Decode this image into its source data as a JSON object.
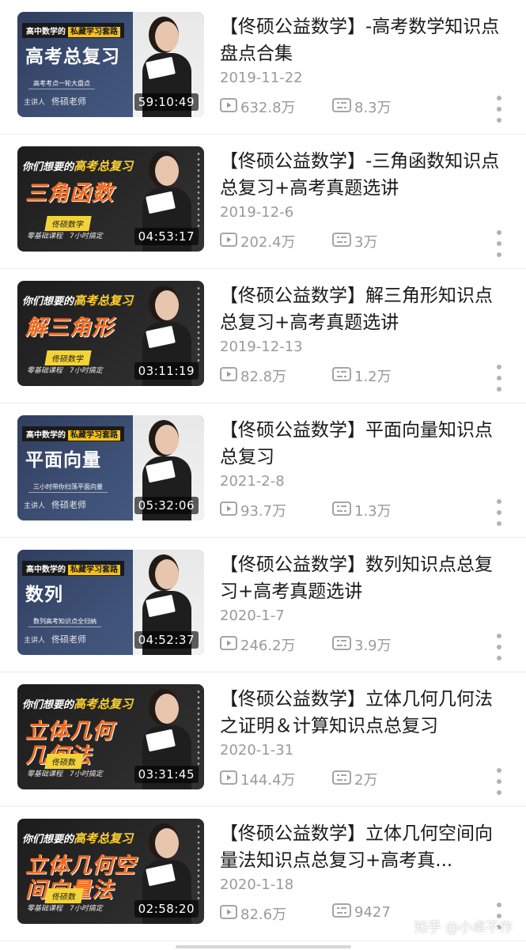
{
  "videos": [
    {
      "style": "blue",
      "cover_top": "高中数学的",
      "cover_top_hl": "私藏学习套路",
      "cover_big": "高考总复习",
      "cover_sub": "高考考点一轮大盘点",
      "cover_foot": "主讲人",
      "cover_name": "佟硕老师",
      "duration": "59:10:49",
      "title": "【佟硕公益数学】-高考数学知识点盘点合集",
      "date": "2019-11-22",
      "views": "632.8万",
      "danmaku": "8.3万"
    },
    {
      "style": "dark",
      "cover_top": "你们想要的",
      "cover_top_hl": "高考总复习",
      "cover_big": "三角函数",
      "cover_sub": "佟硕数学",
      "cover_foot": "零基础课程　7小时搞定",
      "cover_name": "",
      "duration": "04:53:17",
      "title": "【佟硕公益数学】-三角函数知识点总复习+高考真题选讲",
      "date": "2019-12-6",
      "views": "202.4万",
      "danmaku": "3万"
    },
    {
      "style": "dark",
      "cover_top": "你们想要的",
      "cover_top_hl": "高考总复习",
      "cover_big": "解三角形",
      "cover_sub": "佟硕数学",
      "cover_foot": "零基础课程　7小时搞定",
      "cover_name": "",
      "duration": "03:11:19",
      "title": "【佟硕公益数学】解三角形知识点总复习+高考真题选讲",
      "date": "2019-12-13",
      "views": "82.8万",
      "danmaku": "1.2万"
    },
    {
      "style": "blue",
      "cover_top": "高中数学的",
      "cover_top_hl": "私藏学习套路",
      "cover_big": "平面向量",
      "cover_sub": "三小时带你扫荡平面向量",
      "cover_foot": "主讲人",
      "cover_name": "佟硕老师",
      "duration": "05:32:06",
      "title": "【佟硕公益数学】平面向量知识点总复习",
      "date": "2021-2-8",
      "views": "93.7万",
      "danmaku": "1.3万"
    },
    {
      "style": "blue",
      "cover_top": "高中数学的",
      "cover_top_hl": "私藏学习套路",
      "cover_big": "数列",
      "cover_sub": "数列高考知识点全归纳",
      "cover_foot": "主讲人",
      "cover_name": "佟硕老师",
      "duration": "04:52:37",
      "title": "【佟硕公益数学】数列知识点总复习+高考真题选讲",
      "date": "2020-1-7",
      "views": "246.2万",
      "danmaku": "3.9万"
    },
    {
      "style": "dark",
      "cover_top": "你们想要的",
      "cover_top_hl": "高考总复习",
      "cover_big": "立体几何\n几何法",
      "cover_sub": "佟硕数",
      "cover_foot": "零基础课程　7小时搞定",
      "cover_name": "",
      "duration": "03:31:45",
      "title": "【佟硕公益数学】立体几何几何法之证明＆计算知识点总复习",
      "date": "2020-1-31",
      "views": "144.4万",
      "danmaku": "2万"
    },
    {
      "style": "dark",
      "cover_top": "你们想要的",
      "cover_top_hl": "高考总复习",
      "cover_big": "立体几何空\n间向量法",
      "cover_sub": "佟硕数",
      "cover_foot": "零基础课程　7小时搞定",
      "cover_name": "",
      "duration": "02:58:20",
      "title": "【佟硕公益数学】立体几何空间向量法知识点总复习+高考真...",
      "date": "2020-1-18",
      "views": "82.6万",
      "danmaku": "9427"
    }
  ],
  "watermark": "知乎 @小卓不作",
  "icons": {
    "views": "play-count-icon",
    "danmaku": "danmaku-count-icon",
    "more": "more-vertical-icon"
  },
  "colors": {
    "meta_text": "#9a9a9a",
    "title_text": "#1a1a1a",
    "divider": "#ececec",
    "cover_orange": "#f26a1f",
    "cover_yellow": "#f5c21b"
  }
}
